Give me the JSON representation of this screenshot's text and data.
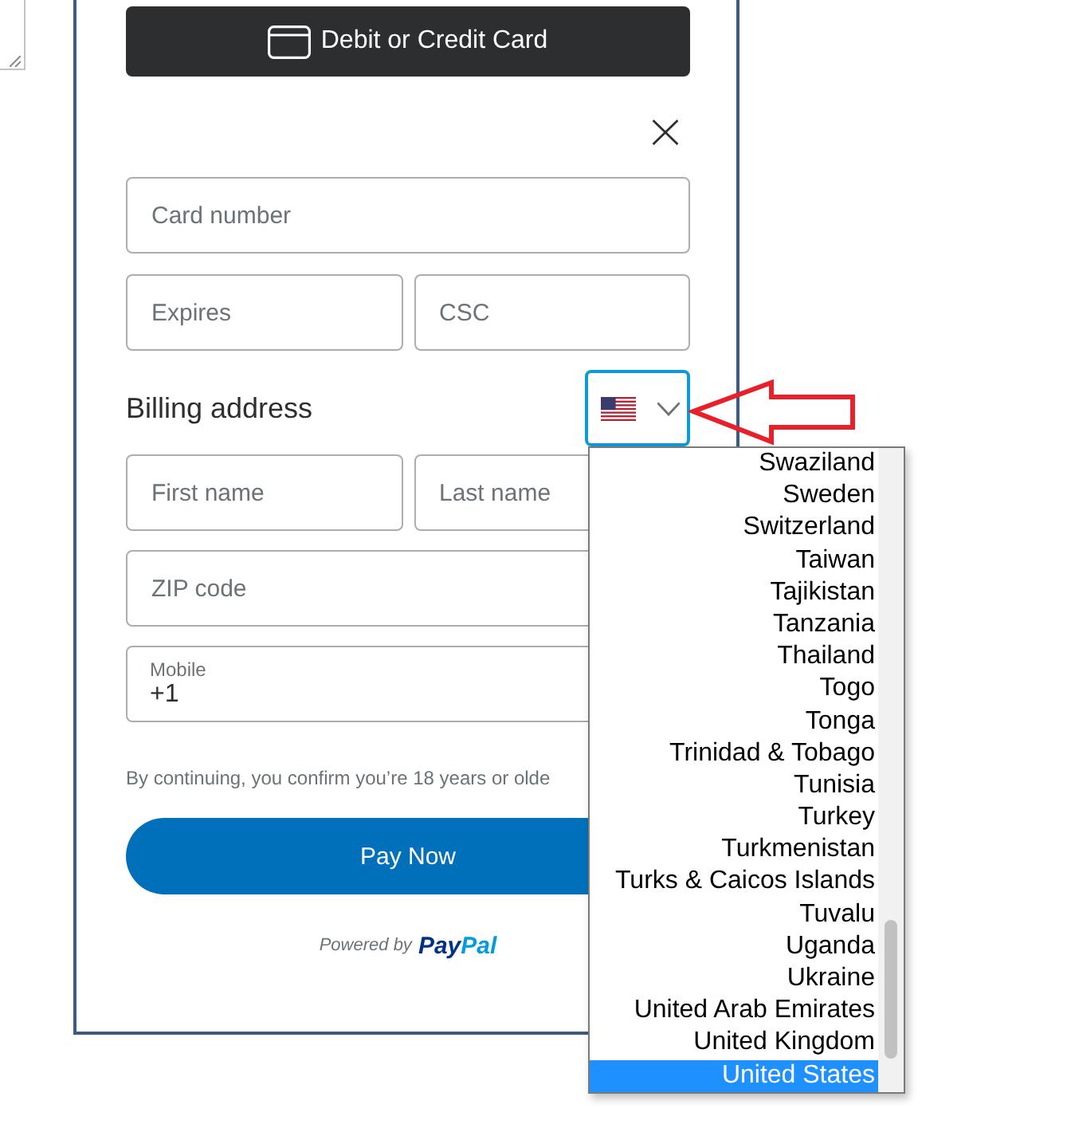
{
  "payment_method": {
    "label": "Debit or Credit Card"
  },
  "card_rows": [
    [
      {
        "kind": "plain",
        "placeholder": "Card number"
      }
    ],
    [
      {
        "kind": "plain",
        "placeholder": "Expires"
      },
      {
        "kind": "plain",
        "placeholder": "CSC"
      }
    ]
  ],
  "billing": {
    "title": "Billing address",
    "country_select": {
      "expanded": true,
      "options": [
        {
          "label": "Swaziland",
          "selected": false
        },
        {
          "label": "Sweden",
          "selected": false
        },
        {
          "label": "Switzerland",
          "selected": false
        },
        {
          "label": "Taiwan",
          "selected": false
        },
        {
          "label": "Tajikistan",
          "selected": false
        },
        {
          "label": "Tanzania",
          "selected": false
        },
        {
          "label": "Thailand",
          "selected": false
        },
        {
          "label": "Togo",
          "selected": false
        },
        {
          "label": "Tonga",
          "selected": false
        },
        {
          "label": "Trinidad & Tobago",
          "selected": false
        },
        {
          "label": "Tunisia",
          "selected": false
        },
        {
          "label": "Turkey",
          "selected": false
        },
        {
          "label": "Turkmenistan",
          "selected": false
        },
        {
          "label": "Turks & Caicos Islands",
          "selected": false
        },
        {
          "label": "Tuvalu",
          "selected": false
        },
        {
          "label": "Uganda",
          "selected": false
        },
        {
          "label": "Ukraine",
          "selected": false
        },
        {
          "label": "United Arab Emirates",
          "selected": false
        },
        {
          "label": "United Kingdom",
          "selected": false
        },
        {
          "label": "United States",
          "selected": true
        }
      ]
    },
    "rows": [
      [
        {
          "kind": "plain",
          "placeholder": "First name"
        },
        {
          "kind": "plain",
          "placeholder": "Last name"
        }
      ],
      [
        {
          "kind": "plain",
          "placeholder": "ZIP code"
        }
      ],
      [
        {
          "kind": "labeled",
          "label": "Mobile",
          "value": "+1"
        }
      ]
    ]
  },
  "disclaimer": "By continuing, you confirm you’re 18 years or olde",
  "pay_button": {
    "label": "Pay Now"
  },
  "footer": {
    "powered_by": "Powered by",
    "logo_parts": [
      "Pay",
      "Pal"
    ]
  }
}
